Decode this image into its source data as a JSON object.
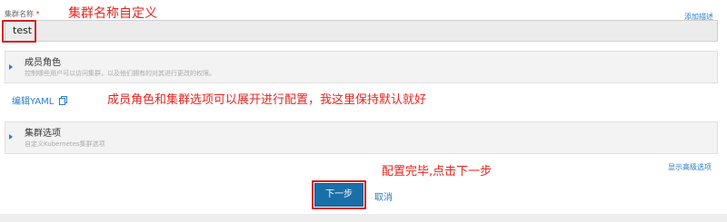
{
  "form": {
    "name_label": "集群名称",
    "required_mark": "*",
    "name_value": "test",
    "add_description": "添加描述",
    "edit_yaml": "编辑YAML",
    "show_advanced": "显示高级选项"
  },
  "panels": [
    {
      "title": "成员角色",
      "description": "控制哪些用户可以访问集群，以及他们拥有的对其进行更改的权限。"
    },
    {
      "title": "集群选项",
      "description": "自定义Kubernetes集群选项"
    }
  ],
  "actions": {
    "next": "下一步",
    "cancel": "取消"
  },
  "annotations": {
    "name_custom": "集群名称自定义",
    "expand_hint": "成员角色和集群选项可以展开进行配置，我这里保持默认就好",
    "done_hint": "配置完毕,点击下一步"
  },
  "colors": {
    "annotation_red": "#e8241e",
    "primary_button": "#1b6fa8",
    "link_blue": "#2a7cc7"
  },
  "icons": {
    "expand": "caret-right-icon",
    "yaml": "copy-icon"
  }
}
